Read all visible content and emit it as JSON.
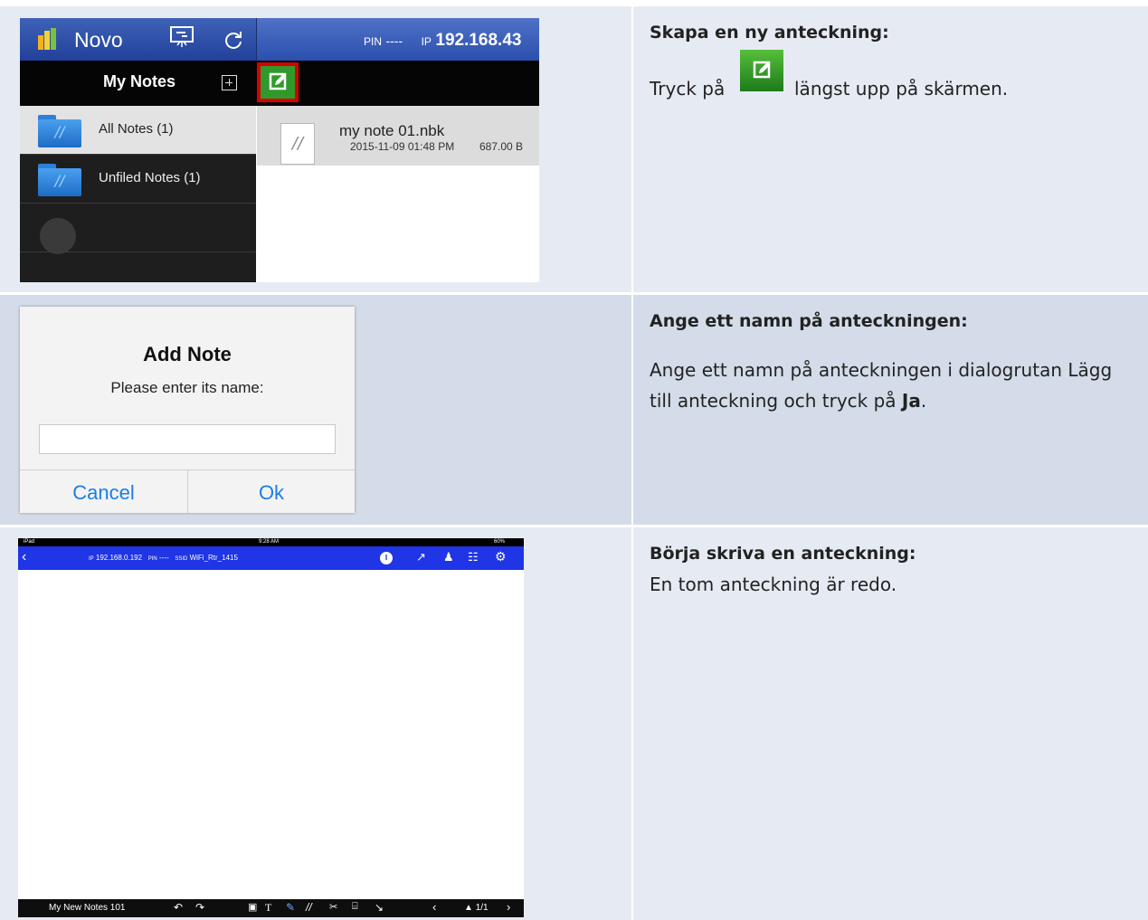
{
  "rows": [
    {
      "heading": "Skapa en ny anteckning:",
      "text_before": "Tryck på",
      "text_after": "längst upp på skärmen."
    },
    {
      "heading": "Ange ett namn på anteckningen:",
      "text_before": "Ange ett namn på anteckningen i dialogrutan Lägg till anteckning och tryck på ",
      "text_bold": "Ja",
      "text_after": "."
    },
    {
      "heading": "Börja skriva en anteckning:",
      "text": "En tom anteckning är redo."
    }
  ],
  "shot1": {
    "app_name": "Novo",
    "pin_label": "PIN",
    "pin_value": "----",
    "ip_label": "IP",
    "ip_value": "192.168.43",
    "my_notes": "My Notes",
    "folders": [
      {
        "label": "All Notes (1)"
      },
      {
        "label": "Unfiled Notes (1)"
      }
    ],
    "file": {
      "name": "my note 01.nbk",
      "date": "2015-11-09 01:48 PM",
      "size": "687.00 B"
    }
  },
  "dialog": {
    "title": "Add Note",
    "message": "Please enter its name:",
    "input_value": "",
    "cancel": "Cancel",
    "ok": "Ok"
  },
  "shot3": {
    "status_left": "iPad",
    "status_time": "9:28 AM",
    "status_battery": "60%",
    "ip_label": "IP",
    "ip": "192.168.0.192",
    "pin_label": "PIN",
    "pin": "----",
    "ssid_label": "SSID",
    "ssid": "WiFi_Rtr_1415",
    "note_name": "My New Notes 101",
    "page": "1/1"
  },
  "colors": {
    "novo_blue": "#2b4fae",
    "note_bar_blue": "#1f35e6",
    "edit_green": "#2f9a2b",
    "highlight_red": "#d90000",
    "link_blue": "#1a7ee6"
  }
}
